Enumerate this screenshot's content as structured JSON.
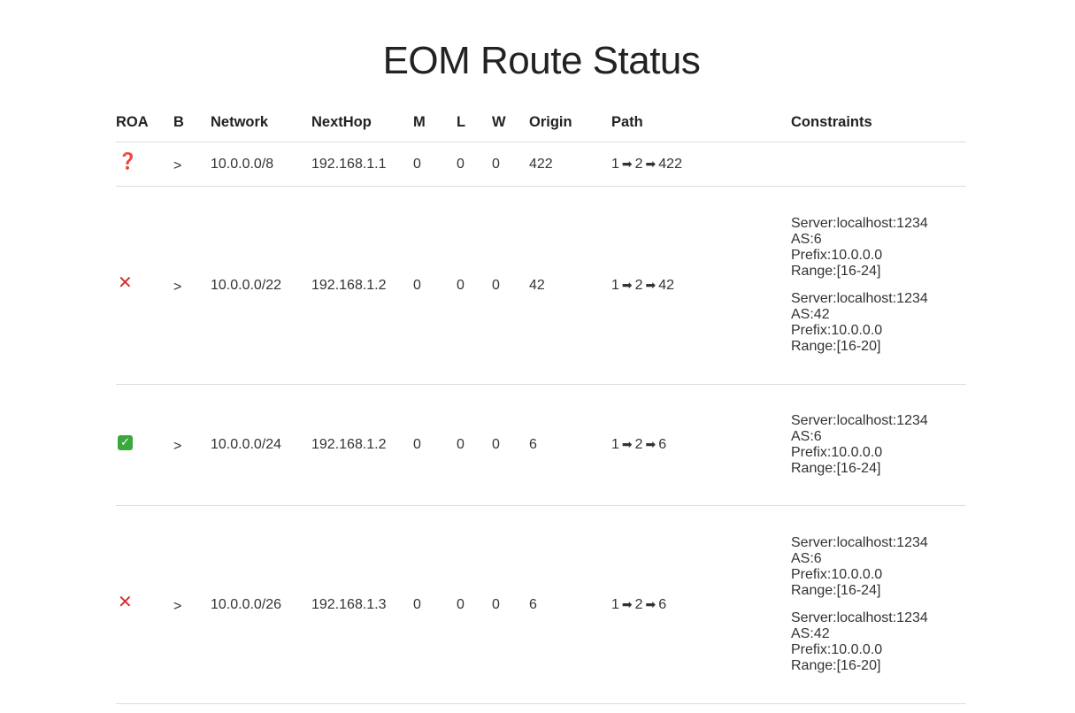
{
  "page": {
    "title": "EOM Route Status"
  },
  "table": {
    "headers": {
      "roa": "ROA",
      "best": "B",
      "network": "Network",
      "nexthop": "NextHop",
      "m": "M",
      "l": "L",
      "w": "W",
      "origin": "Origin",
      "path": "Path",
      "constraints": "Constraints"
    },
    "path_arrow": "➡",
    "rows": [
      {
        "roa_status": "unknown",
        "roa_icon": "❓",
        "best": ">",
        "network": "10.0.0.0/8",
        "nexthop": "192.168.1.1",
        "m": "0",
        "l": "0",
        "w": "0",
        "origin": "422",
        "path": [
          "1",
          "2",
          "422"
        ],
        "constraints": []
      },
      {
        "roa_status": "invalid",
        "roa_icon": "✕",
        "best": ">",
        "network": "10.0.0.0/22",
        "nexthop": "192.168.1.2",
        "m": "0",
        "l": "0",
        "w": "0",
        "origin": "42",
        "path": [
          "1",
          "2",
          "42"
        ],
        "constraints": [
          {
            "server": "Server:localhost:1234",
            "as": "AS:6",
            "prefix": "Prefix:10.0.0.0",
            "range": "Range:[16-24]"
          },
          {
            "server": "Server:localhost:1234",
            "as": "AS:42",
            "prefix": "Prefix:10.0.0.0",
            "range": "Range:[16-20]"
          }
        ]
      },
      {
        "roa_status": "valid",
        "roa_icon": "✓",
        "best": ">",
        "network": "10.0.0.0/24",
        "nexthop": "192.168.1.2",
        "m": "0",
        "l": "0",
        "w": "0",
        "origin": "6",
        "path": [
          "1",
          "2",
          "6"
        ],
        "constraints": [
          {
            "server": "Server:localhost:1234",
            "as": "AS:6",
            "prefix": "Prefix:10.0.0.0",
            "range": "Range:[16-24]"
          }
        ]
      },
      {
        "roa_status": "invalid",
        "roa_icon": "✕",
        "best": ">",
        "network": "10.0.0.0/26",
        "nexthop": "192.168.1.3",
        "m": "0",
        "l": "0",
        "w": "0",
        "origin": "6",
        "path": [
          "1",
          "2",
          "6"
        ],
        "constraints": [
          {
            "server": "Server:localhost:1234",
            "as": "AS:6",
            "prefix": "Prefix:10.0.0.0",
            "range": "Range:[16-24]"
          },
          {
            "server": "Server:localhost:1234",
            "as": "AS:42",
            "prefix": "Prefix:10.0.0.0",
            "range": "Range:[16-20]"
          }
        ]
      }
    ]
  },
  "colors": {
    "unknown_icon": "#d0292c",
    "invalid_icon": "#d62f2f",
    "valid_icon_bg": "#3aa83a",
    "row_divider": "#dddddd"
  },
  "icons": {
    "unknown": "question-mark-icon",
    "invalid": "cross-mark-icon",
    "valid": "check-mark-icon"
  }
}
